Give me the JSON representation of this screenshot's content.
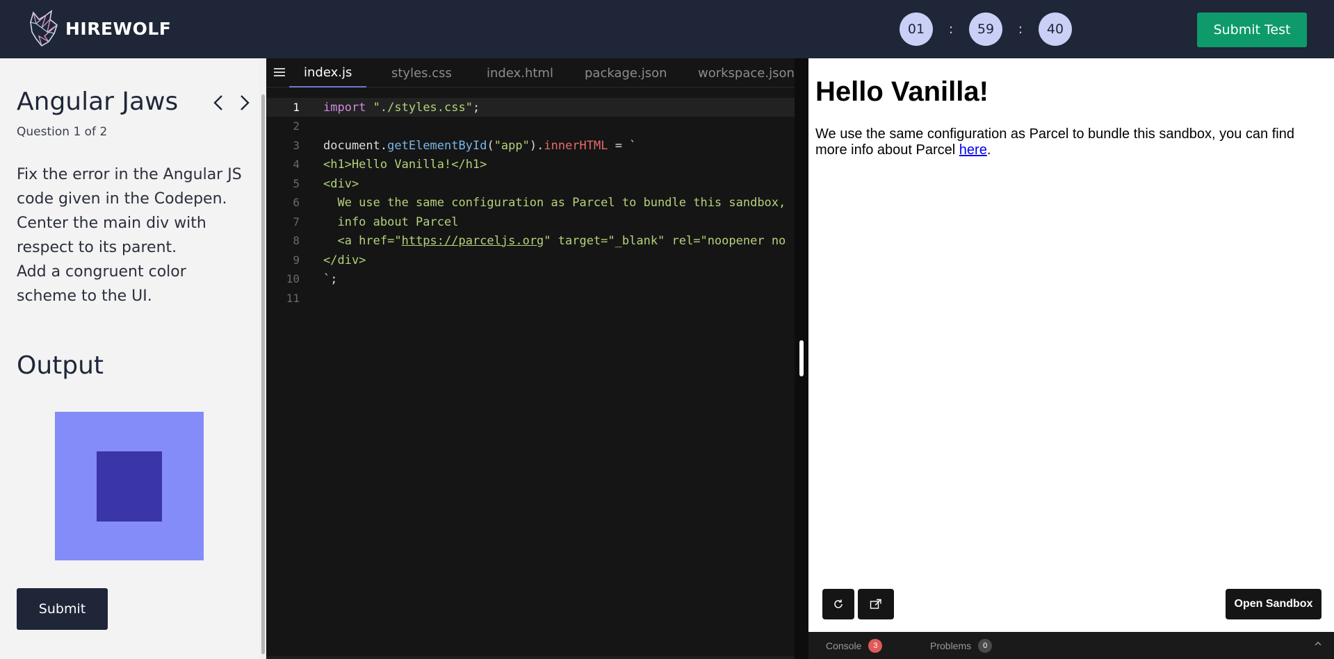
{
  "header": {
    "brand": "HIREWOLF",
    "timer": {
      "hours": "01",
      "minutes": "59",
      "seconds": "40",
      "separator": ":"
    },
    "submit_test_label": "Submit Test"
  },
  "question": {
    "title": "Angular Jaws",
    "counter": "Question 1 of 2",
    "description": [
      "Fix the error in the Angular JS code given in the Codepen.",
      "Center the main div with respect to its parent.",
      "Add a congruent color scheme to the UI."
    ],
    "output_title": "Output",
    "submit_label": "Submit",
    "output_colors": {
      "outer": "#838cf8",
      "inner": "#3a35a9"
    }
  },
  "editor": {
    "tabs": [
      "index.js",
      "styles.css",
      "index.html",
      "package.json",
      "workspace.json"
    ],
    "active_tab": "index.js",
    "line_numbers": [
      "1",
      "2",
      "3",
      "4",
      "5",
      "6",
      "7",
      "8",
      "9",
      "10",
      "11"
    ],
    "lines": [
      "import \"./styles.css\";",
      "",
      "document.getElementById(\"app\").innerHTML = `",
      "<h1>Hello Vanilla!</h1>",
      "<div>",
      "  We use the same configuration as Parcel to bundle this sandbox,",
      "  info about Parcel",
      "  <a href=\"https://parceljs.org\" target=\"_blank\" rel=\"noopener no",
      "</div>",
      "`;",
      ""
    ],
    "tokens": {
      "import": "import",
      "import_path": "\"./styles.css\"",
      "semicolon": ";",
      "document": "document",
      "dot": ".",
      "get_by_id": "getElementById",
      "paren_open": "(",
      "app": "\"app\"",
      "paren_close": ")",
      "inner_html": "innerHTML",
      "assign": " = `",
      "h1_line": "<h1>Hello Vanilla!</h1>",
      "div_open": "<div>",
      "line6": "  We use the same configuration as Parcel to bundle this sandbox,",
      "line7": "  info about Parcel",
      "a_open": "  <a href=\"",
      "a_url": "https://parceljs.org",
      "a_rest": "\" target=\"_blank\" rel=\"noopener no",
      "div_close": "</div>",
      "end": "`;"
    }
  },
  "preview": {
    "heading": "Hello Vanilla!",
    "paragraph": "We use the same configuration as Parcel to bundle this sandbox, you can find more info about Parcel ",
    "link_text": "here",
    "after_link": ".",
    "open_sandbox_label": "Open Sandbox",
    "console_label": "Console",
    "console_count": "3",
    "problems_label": "Problems",
    "problems_count": "0"
  }
}
